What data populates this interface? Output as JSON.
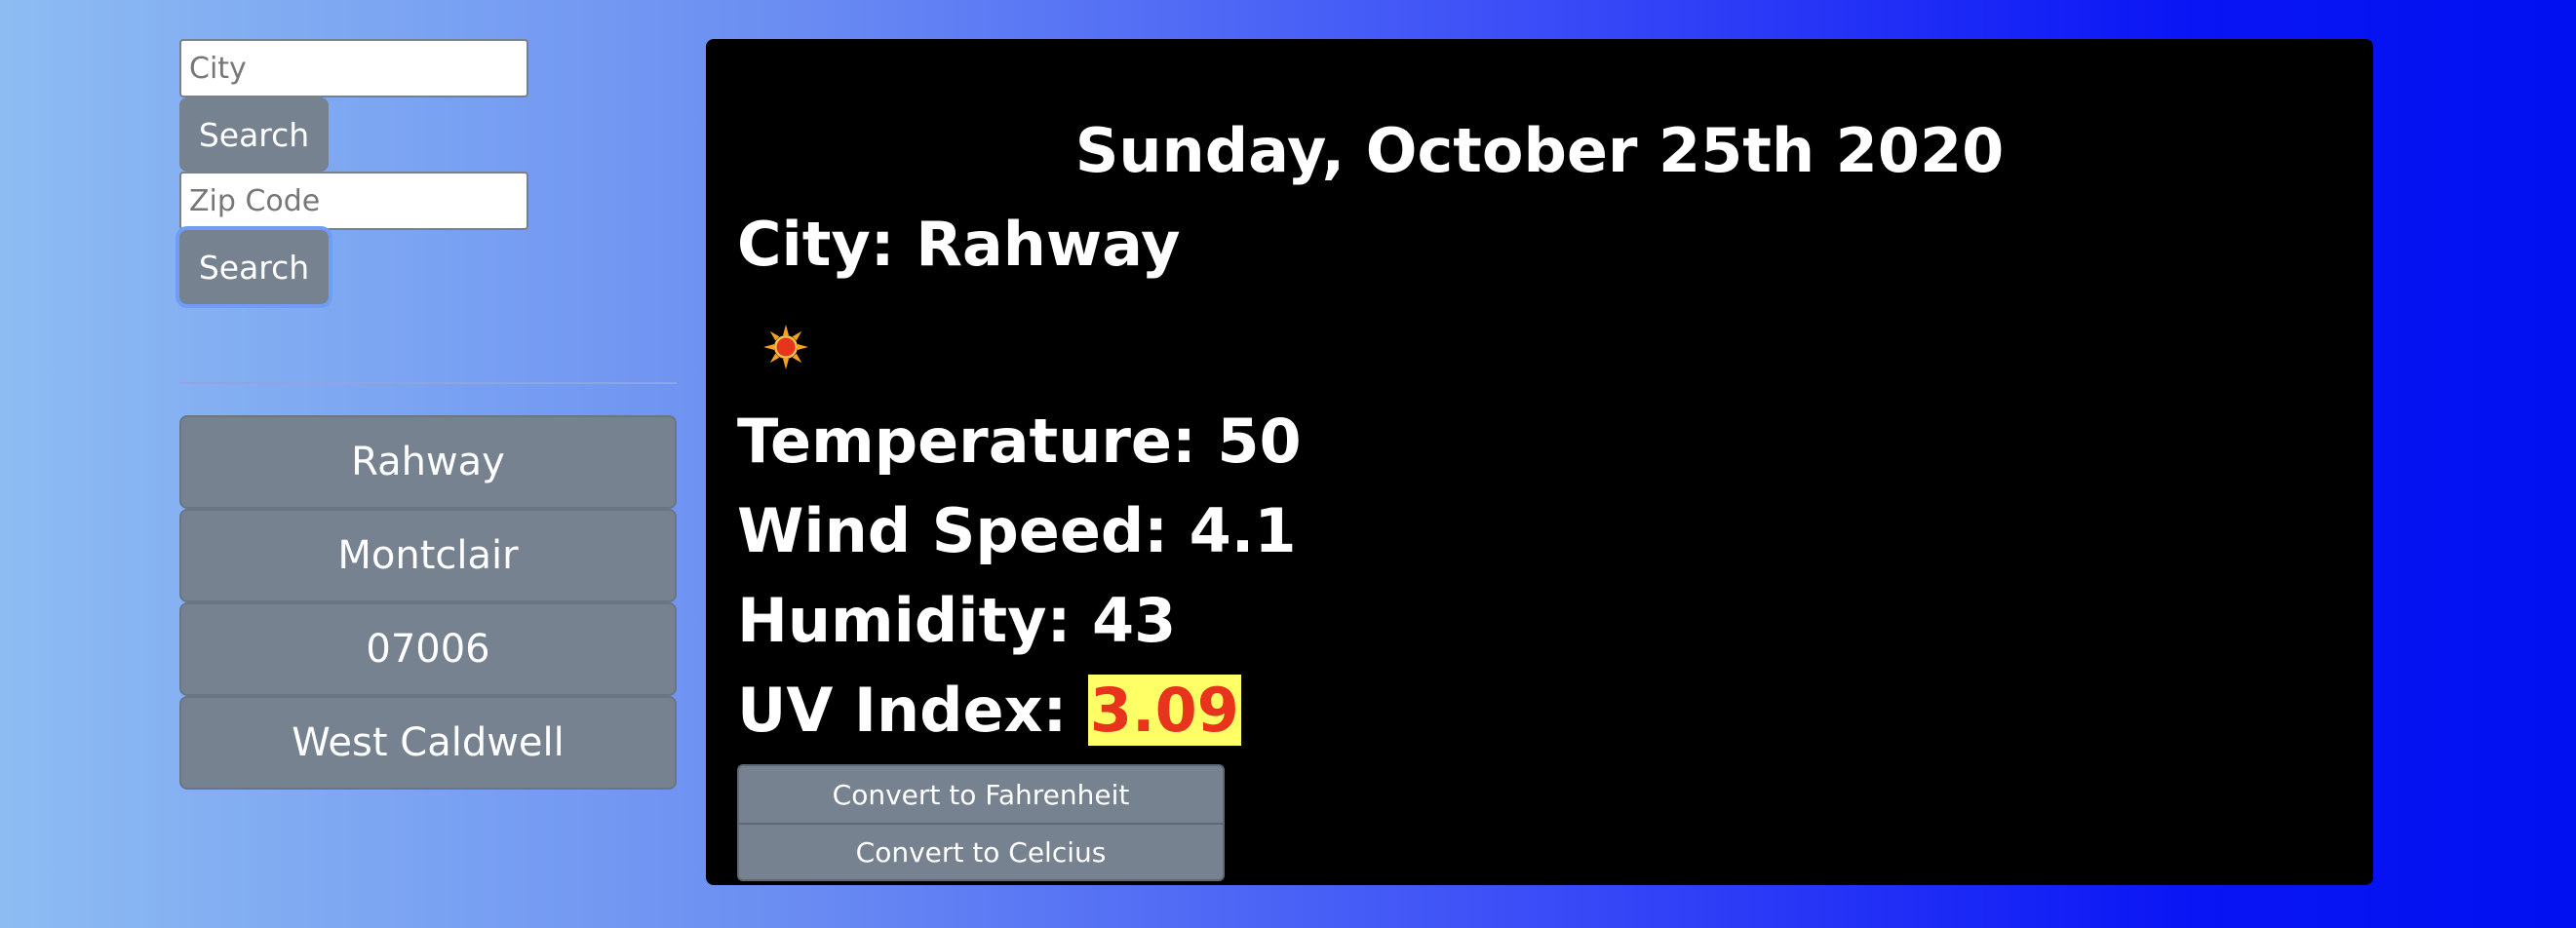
{
  "search": {
    "city_placeholder": "City",
    "city_button": "Search",
    "zip_placeholder": "Zip Code",
    "zip_button": "Search"
  },
  "history": [
    "Rahway",
    "Montclair",
    "07006",
    "West Caldwell"
  ],
  "weather": {
    "date": "Sunday, October 25th 2020",
    "city_label": "City: ",
    "city": "Rahway",
    "icon": "sun-icon",
    "temperature_label": "Temperature: ",
    "temperature": "50",
    "wind_label": "Wind Speed: ",
    "wind": "4.1",
    "humidity_label": "Humidity: ",
    "humidity": "43",
    "uv_label": "UV Index: ",
    "uv": "3.09",
    "uv_bg_color": "#ffff66",
    "uv_text_color": "#e8341c"
  },
  "buttons": {
    "to_fahrenheit": "Convert to Fahrenheit",
    "to_celsius": "Convert to Celcius"
  }
}
